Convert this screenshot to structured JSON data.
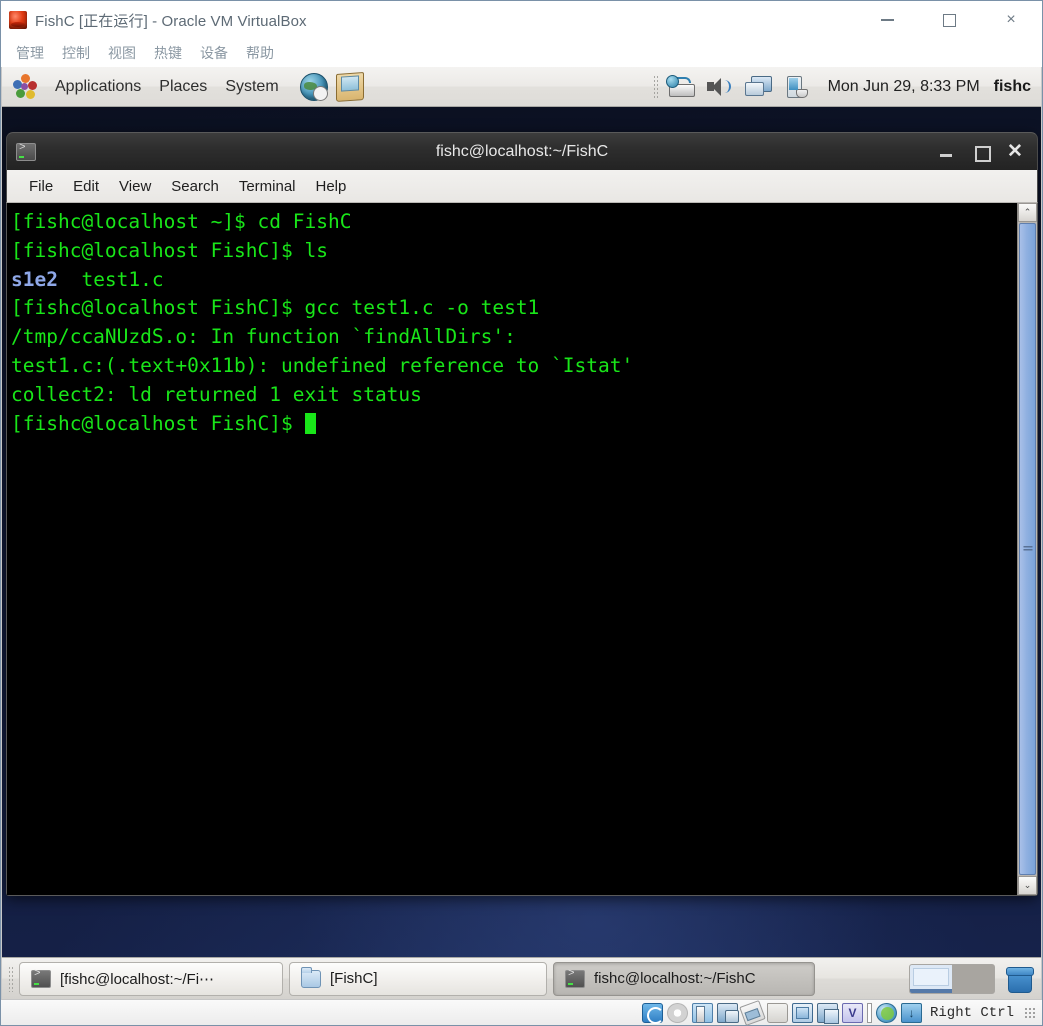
{
  "vbox": {
    "title": "FishC [正在运行] - Oracle VM VirtualBox",
    "app_icon": "virtualbox-icon",
    "window_controls": {
      "minimize": "minimize-icon",
      "maximize": "maximize-icon",
      "close": "×"
    },
    "menus": [
      {
        "label": "管理"
      },
      {
        "label": "控制"
      },
      {
        "label": "视图"
      },
      {
        "label": "热键"
      },
      {
        "label": "设备"
      },
      {
        "label": "帮助"
      }
    ],
    "statusbar": {
      "host_key": "Right Ctrl",
      "icons": [
        "hard-disk-icon",
        "optical-disk-icon",
        "audio-icon",
        "network-icon",
        "usb-icon",
        "shared-folders-icon",
        "display-icon",
        "window-icon",
        "virtualbox-logo-icon",
        "capture-bar-icon",
        "guest-additions-icon",
        "host-mouse-icon"
      ],
      "vbox_badge": "V"
    }
  },
  "gnome_top_panel": {
    "app_icon": "gnome-foot-icon",
    "menus": [
      {
        "label": "Applications"
      },
      {
        "label": "Places"
      },
      {
        "label": "System"
      }
    ],
    "launchers": [
      {
        "name": "web-browser-icon"
      },
      {
        "name": "email-client-icon"
      }
    ],
    "tray_icons": [
      "network-manager-icon",
      "volume-icon",
      "display-icon",
      "battery-icon"
    ],
    "clock": "Mon Jun 29,  8:33 PM",
    "user": "fishc"
  },
  "terminal": {
    "title": "fishc@localhost:~/FishC",
    "icon": "terminal-icon",
    "window_controls": {
      "minimize": "minimize-icon",
      "maximize": "maximize-icon",
      "close": "✕"
    },
    "menus": [
      {
        "label": "File"
      },
      {
        "label": "Edit"
      },
      {
        "label": "View"
      },
      {
        "label": "Search"
      },
      {
        "label": "Terminal"
      },
      {
        "label": "Help"
      }
    ],
    "lines": [
      {
        "segments": [
          {
            "text": "[fishc@localhost ~]$ cd FishC",
            "style": "green"
          }
        ]
      },
      {
        "segments": [
          {
            "text": "[fishc@localhost FishC]$ ls",
            "style": "green"
          }
        ]
      },
      {
        "segments": [
          {
            "text": "s1e2",
            "style": "dir"
          },
          {
            "text": "  test1.c",
            "style": "green"
          }
        ]
      },
      {
        "segments": [
          {
            "text": "[fishc@localhost FishC]$ gcc test1.c -o test1",
            "style": "green"
          }
        ]
      },
      {
        "segments": [
          {
            "text": "/tmp/ccaNUzdS.o: In function `findAllDirs':",
            "style": "green"
          }
        ]
      },
      {
        "segments": [
          {
            "text": "test1.c:(.text+0x11b): undefined reference to `Istat'",
            "style": "green"
          }
        ]
      },
      {
        "segments": [
          {
            "text": "collect2: ld returned 1 exit status",
            "style": "green"
          }
        ]
      },
      {
        "segments": [
          {
            "text": "[fishc@localhost FishC]$ ",
            "style": "green"
          },
          {
            "text": "",
            "style": "cursor"
          }
        ]
      }
    ],
    "scrollbar": {
      "up_arrow": "⌃",
      "down_arrow": "⌄"
    }
  },
  "gnome_bottom_panel": {
    "tasks": [
      {
        "label": "[fishc@localhost:~/Fi⋯",
        "icon": "terminal-icon",
        "active": false
      },
      {
        "label": "[FishC]",
        "icon": "folder-icon",
        "active": false
      },
      {
        "label": "fishc@localhost:~/FishC",
        "icon": "terminal-icon",
        "active": true
      }
    ],
    "workspaces": [
      {
        "current": true
      },
      {
        "current": false
      }
    ],
    "trash": "trash-icon"
  },
  "colors": {
    "terminal_bg": "#000000",
    "terminal_green": "#19e619",
    "terminal_dir_blue": "#8fa8e8",
    "desktop_bg": "#101835",
    "panel_bg": "#e9e7e4"
  }
}
